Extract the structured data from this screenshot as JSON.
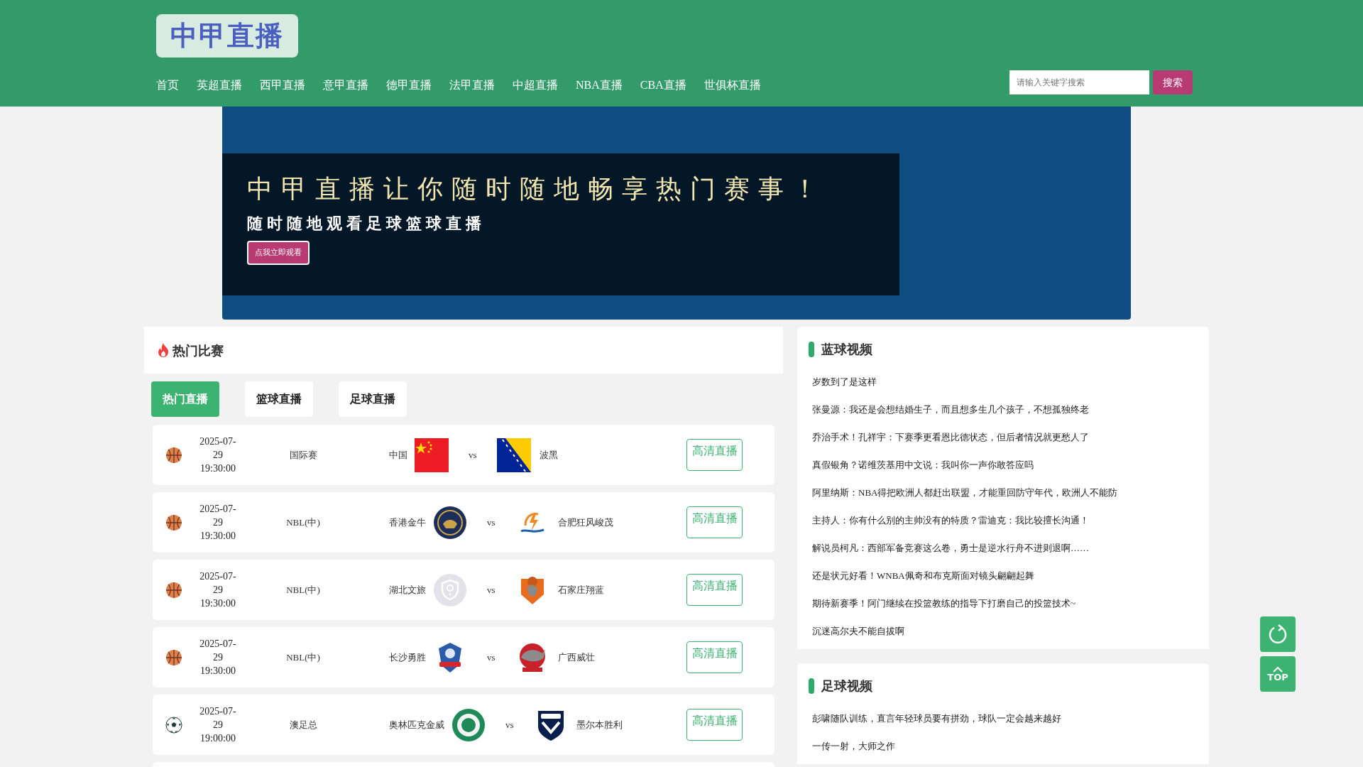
{
  "logo": {
    "text": "中甲直播"
  },
  "nav": [
    {
      "label": "首页",
      "selected": false
    },
    {
      "label": "英超直播",
      "selected": false
    },
    {
      "label": "西甲直播",
      "selected": false
    },
    {
      "label": "意甲直播",
      "selected": false
    },
    {
      "label": "德甲直播",
      "selected": false
    },
    {
      "label": "法甲直播",
      "selected": false
    },
    {
      "label": "中超直播",
      "selected": false
    },
    {
      "label": "NBA直播",
      "selected": false
    },
    {
      "label": "CBA直播",
      "selected": false
    },
    {
      "label": "世俱杯直播",
      "selected": false
    }
  ],
  "search": {
    "placeholder": "请输入关键字搜索",
    "button": "搜索"
  },
  "banner": {
    "title": "中甲直播让你随时随地畅享热门赛事！",
    "subtitle": "随时随地观看足球篮球直播",
    "button": "点我立即观看"
  },
  "hot": {
    "title": "热门比赛",
    "tabs": [
      {
        "label": "热门直播",
        "selected": true
      },
      {
        "label": "篮球直播",
        "selected": false
      },
      {
        "label": "足球直播",
        "selected": false
      }
    ],
    "matches": [
      {
        "kind": "basketball",
        "date": "2025-07-",
        "day": "29",
        "time": "19:30:00",
        "league": "国际赛",
        "home": {
          "name": "中国",
          "kind": "flag_cn"
        },
        "away": {
          "name": "波黑",
          "kind": "flag_ba"
        },
        "vs": "vs",
        "button": "高清直播"
      },
      {
        "kind": "basketball",
        "date": "2025-07-",
        "day": "29",
        "time": "19:30:00",
        "league": "NBL(中)",
        "home": {
          "name": "香港金牛",
          "kind": "navy"
        },
        "away": {
          "name": "合肥狂风峻茂",
          "kind": "bolt"
        },
        "vs": "vs",
        "button": "高清直播"
      },
      {
        "kind": "basketball",
        "date": "2025-07-",
        "day": "29",
        "time": "19:30:00",
        "league": "NBL(中)",
        "home": {
          "name": "湖北文旅",
          "kind": "unknown"
        },
        "away": {
          "name": "石家庄翔蓝",
          "kind": "orange"
        },
        "vs": "vs",
        "button": "高清直播"
      },
      {
        "kind": "basketball",
        "date": "2025-07-",
        "day": "29",
        "time": "19:30:00",
        "league": "NBL(中)",
        "home": {
          "name": "长沙勇胜",
          "kind": "lion"
        },
        "away": {
          "name": "广西威壮",
          "kind": "rhino"
        },
        "vs": "vs",
        "button": "高清直播"
      },
      {
        "kind": "football",
        "date": "2025-07-",
        "day": "29",
        "time": "19:00:00",
        "league": "澳足总",
        "home": {
          "name": "奥林匹克金威",
          "kind": "green"
        },
        "away": {
          "name": "墨尔本胜利",
          "kind": "shield"
        },
        "vs": "vs",
        "button": "高清直播"
      }
    ]
  },
  "basketball_videos": {
    "title": "蓝球视频",
    "items": [
      "岁数到了是这样",
      "张曼源：我还是会想结婚生子，而且想多生几个孩子，不想孤独终老",
      "乔治手术！孔祥宇：下赛季更看恩比德状态，但后者情况就更愁人了",
      "真假银角？诺维茨基用中文说：我叫你一声你敢答应吗",
      "阿里纳斯：NBA得把欧洲人都赶出联盟，才能重回防守年代，欧洲人不能防",
      "主持人：你有什么别的主帅没有的特质？雷迪克：我比较擅长沟通！",
      "解说员柯凡：西部军备竞赛这么卷，勇士是逆水行舟不进则退啊……",
      "还是状元好看！WNBA佩奇和布克斯面对镜头翩翩起舞",
      "期待新赛季！阿门继续在投篮教练的指导下打磨自己的投篮技术~",
      "沉迷高尔夫不能自拔啊"
    ]
  },
  "football_videos": {
    "title": "足球视频",
    "items": [
      "彭啸随队训练，直言年轻球员要有拼劲，球队一定会越来越好",
      "一传一射，大师之作"
    ]
  },
  "float": {
    "top": "TOP"
  }
}
